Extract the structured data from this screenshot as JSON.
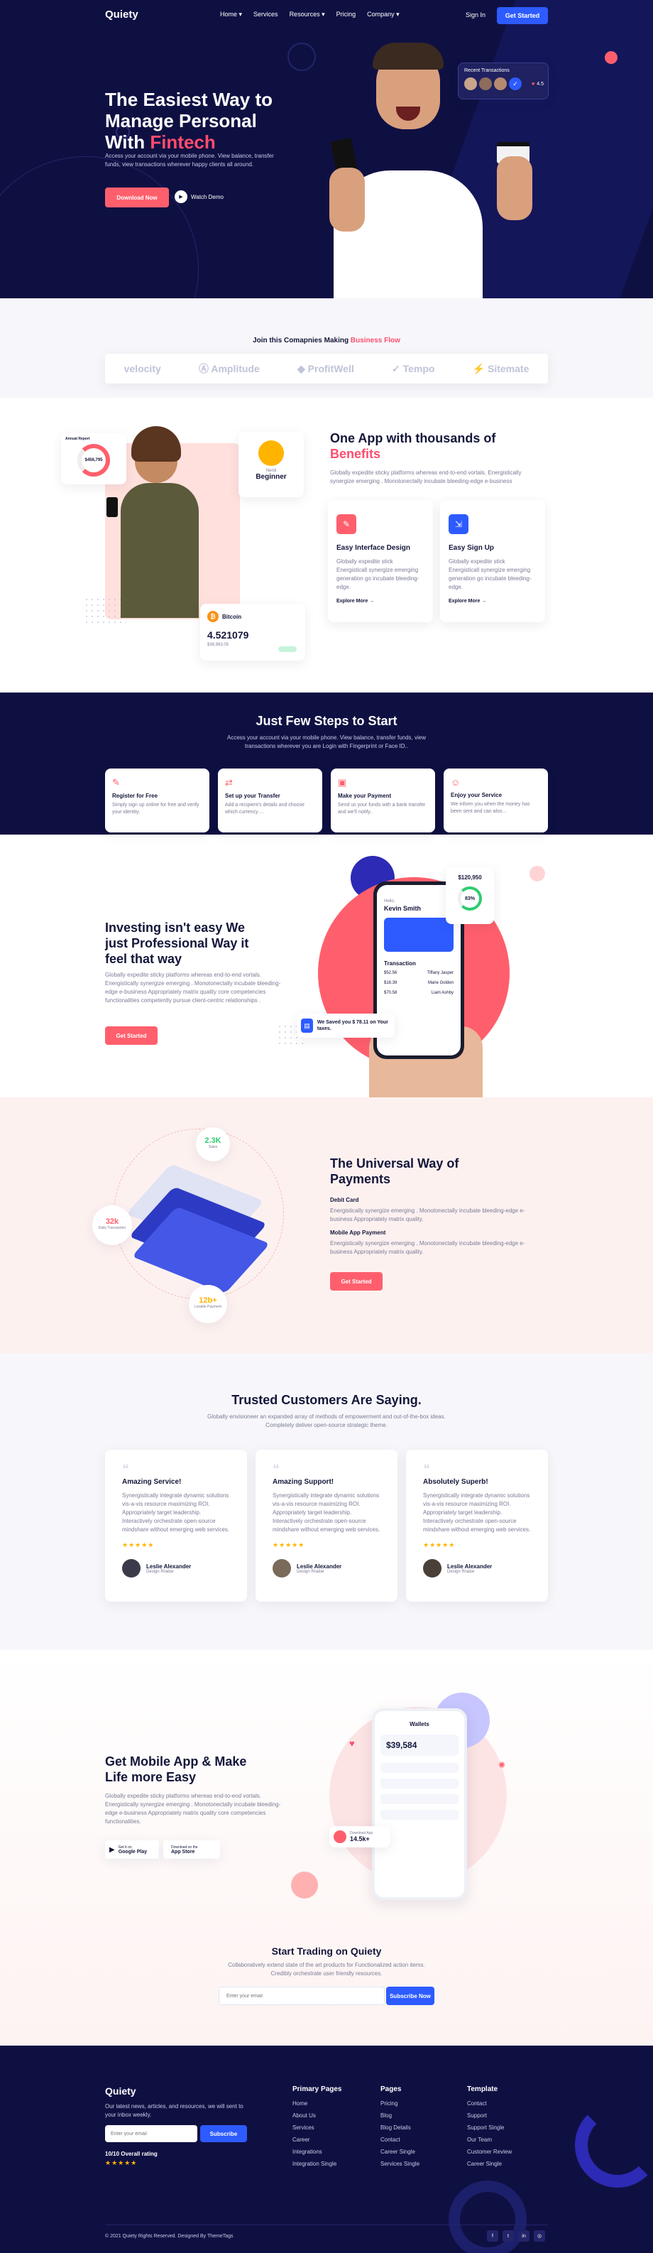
{
  "nav": {
    "logo": "Quiety",
    "items": [
      "Home",
      "Services",
      "Resources",
      "Pricing",
      "Company"
    ],
    "signin": "Sign In",
    "cta": "Get Started"
  },
  "hero": {
    "title_1": "The Easiest Way to",
    "title_2": "Manage Personal",
    "title_3": "With",
    "title_accent": "Fintech",
    "desc": "Access your account via your mobile phone. View balance, transfer funds, view transactions wherever happy clients all around.",
    "btn_download": "Download Now",
    "btn_watch": "Watch Demo",
    "recent_label": "Recent Transactions",
    "rating": "4.5"
  },
  "companies": {
    "title": "Join this Comapnies Making",
    "title_accent": "Business Flow",
    "logos": [
      "velocity",
      "Amplitude",
      "ProfitWell",
      "Tempo",
      "Sitemate"
    ]
  },
  "app": {
    "title": "One App with thousands of",
    "title_accent": "Benefits",
    "desc": "Globally expedite sticky platforms whereas end-to-end vortals. Energistically synergize emerging . Monotonectally incubate bleeding-edge e-business",
    "features": [
      {
        "title": "Easy Interface Design",
        "desc": "Globally expedite stick Energisticall synergize emerging generation go incubate bleeding-edge.",
        "link": "Explore More"
      },
      {
        "title": "Easy Sign Up",
        "desc": "Globally expedite stick Energisticall synergize emerging generation go incubate bleeding-edge.",
        "link": "Explore More"
      }
    ],
    "report_label": "Annual Report",
    "report_amount": "$456,795",
    "level_label": "Nerdi",
    "level": "Beginner",
    "coin": "Bitcoin",
    "coin_value": "4.521079",
    "coin_sub": "$38,983.05"
  },
  "steps": {
    "title": "Just Few Steps to Start",
    "desc_1": "Access your account via your mobile phone. View balance, transfer funds, view",
    "desc_2": "transactions wherever you are Login with Fingerprint or Face ID..",
    "items": [
      {
        "title": "Register for Free",
        "desc": "Simply sign up online for free and verify your identity."
      },
      {
        "title": "Set up your Transfer",
        "desc": "Add a recipient's details and choose which currency ..."
      },
      {
        "title": "Make your Payment",
        "desc": "Send us your funds with a bank transfer and we'll notify.."
      },
      {
        "title": "Enjoy your Service",
        "desc": "We inform you when the money has been sent and can also..."
      }
    ]
  },
  "invest": {
    "title_1": "Investing isn't easy We",
    "title_2": "just Professional Way it",
    "title_3": "feel that way",
    "desc": "Globally expedite sticky platforms whereas end-to-end vortals. Energistically synergize emerging . Monotonectally incubate bleeding-edge e-business Appropriately matrix quality core competencies functionalities competently pursue client-centric relationships .",
    "btn": "Get Started",
    "phone_user": "Kevin Smith",
    "phone_hello": "Hello,",
    "stat_value": "$120,950",
    "stat_pct": "83%",
    "transaction": "Transaction",
    "saved_note": "We Saved you $ 78.11 on Your taxes.",
    "tx": [
      {
        "name": "Tiffany Jasper",
        "amount": "$52.56"
      },
      {
        "name": "Marie Golden",
        "amount": "$18.39"
      },
      {
        "name": "Liam Ashby",
        "amount": "$70.58"
      }
    ]
  },
  "payments": {
    "title_1": "The Universal Way of",
    "title_2": "Payments",
    "sub1": "Debit Card",
    "desc1": "Energistically synergize emerging . Monotonectally incubate bleeding-edge e-business Appropriately matrix quality.",
    "sub2": "Mobile App Payment",
    "desc2": "Energistically synergize emerging . Monotonectally incubate bleeding-edge e-business Appropriately matrix quality.",
    "btn": "Get Started",
    "b1_value": "2.3K",
    "b1_label": "Sales",
    "b2_value": "32k",
    "b2_label": "Daily Transaction",
    "b3_value": "12b+",
    "b3_label": "Lorable Payment"
  },
  "testimonials": {
    "title": "Trusted Customers Are Saying.",
    "desc_1": "Globally envisioneer an expanded array of methods of empowerment and out-of-the-box ideas.",
    "desc_2": "Completely deliver open-source strategic theme.",
    "cards": [
      {
        "title": "Amazing Service!",
        "text": "Synergistically integrate dynamic solutions vis-a-vis resource maximizing ROI. Appropriately target leadership. Interactively orchestrate open-source mindshare without emerging web services.",
        "name": "Leslie Alexander",
        "role": "Design Rradar"
      },
      {
        "title": "Amazing Support!",
        "text": "Synergistically integrate dynamic solutions vis-a-vis resource maximizing ROI. Appropriately target leadership. Interactively orchestrate open-source mindshare without emerging web services.",
        "name": "Leslie Alexander",
        "role": "Design Rradar"
      },
      {
        "title": "Absolutely Superb!",
        "text": "Synergistically integrate dynamic solutions vis-a-vis resource maximizing ROI. Appropriately target leadership. Interactively orchestrate open-source mindshare without emerging web services.",
        "name": "Leslie Alexander",
        "role": "Design Rradar"
      }
    ]
  },
  "mobile": {
    "title_1": "Get Mobile App & Make",
    "title_2": "Life more Easy",
    "desc": "Globally expedite sticky platforms whereas end-to-end vortals. Energistically synergize emerging . Monotonectally incubate bleeding-edge e-business Appropriately matrix quality core competencies functionalities.",
    "gplay_small": "Get it on",
    "gplay": "Google Play",
    "appstore_small": "Download on the",
    "appstore": "App Store",
    "wallets": "Wallets",
    "balance": "$39,584",
    "download_label": "Download App",
    "downloads": "14.5k+"
  },
  "trading": {
    "title": "Start Trading on Quiety",
    "desc_1": "Collaboratively extend state of the art products for Functionalized action items.",
    "desc_2": "Credibly orchestrate user friendly resources.",
    "placeholder": "Enter your email",
    "btn": "Subscribe Now"
  },
  "footer": {
    "logo": "Quiety",
    "desc": "Our latest news, articles, and resources, we will sent to your inbox weekly.",
    "placeholder": "Enter your email",
    "subscribe": "Subscribe",
    "rating": "10/10 Overall rating",
    "cols": [
      {
        "title": "Primary Pages",
        "items": [
          "Home",
          "About Us",
          "Services",
          "Career",
          "Integrations",
          "Integration Single"
        ]
      },
      {
        "title": "Pages",
        "items": [
          "Pricing",
          "Blog",
          "Blog Details",
          "Contact",
          "Career Single",
          "Services Single"
        ]
      },
      {
        "title": "Template",
        "items": [
          "Contact",
          "Support",
          "Support Single",
          "Our Team",
          "Customer Review",
          "Career Single"
        ]
      }
    ],
    "copyright": "© 2021 Quiety Rights Reserved. Designed By ThemeTags",
    "social": [
      "f",
      "t",
      "in",
      "◎"
    ]
  },
  "colors": {
    "navy": "#0f1042",
    "pink": "#ff5f6d",
    "blue": "#2d5bff"
  }
}
